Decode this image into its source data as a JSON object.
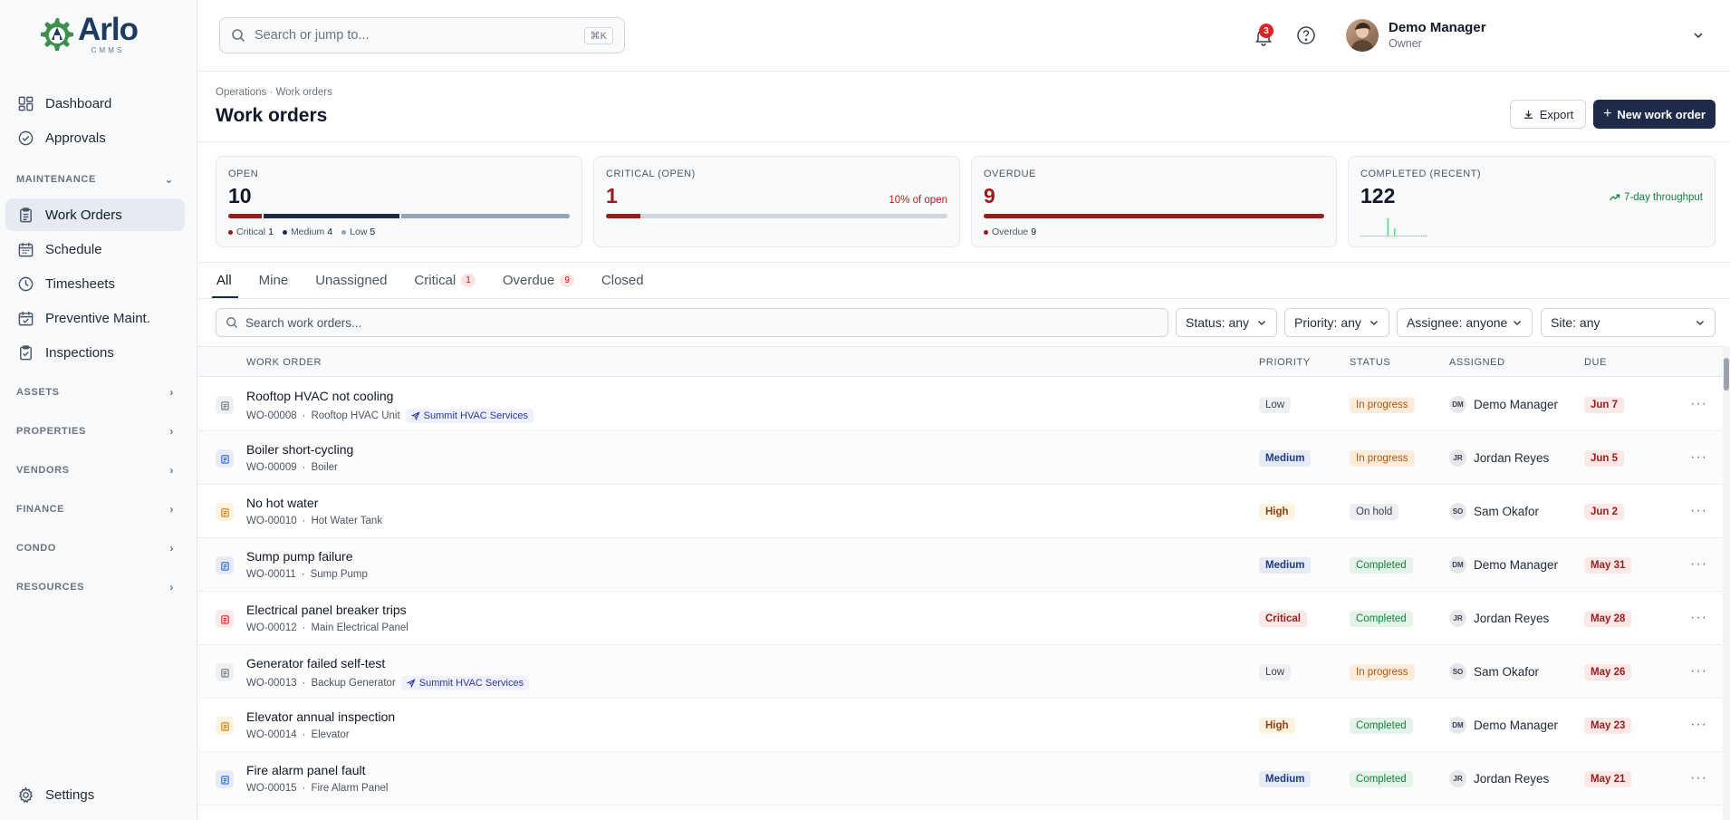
{
  "brand": {
    "name": "Arlo",
    "sub": "CMMS",
    "primary": "#1e3a5f",
    "accent": "#3d8f4e"
  },
  "sidebar": {
    "top_items": [
      {
        "label": "Dashboard",
        "icon": "dashboard-icon"
      },
      {
        "label": "Approvals",
        "icon": "check-circle-icon"
      }
    ],
    "maintenance": {
      "label": "MAINTENANCE",
      "items": [
        {
          "label": "Work Orders",
          "icon": "clipboard-icon",
          "active": true
        },
        {
          "label": "Schedule",
          "icon": "calendar-icon"
        },
        {
          "label": "Timesheets",
          "icon": "clock-icon"
        },
        {
          "label": "Preventive Maint.",
          "icon": "calendar-check-icon"
        },
        {
          "label": "Inspections",
          "icon": "clipboard-check-icon"
        }
      ]
    },
    "sections": [
      "ASSETS",
      "PROPERTIES",
      "VENDORS",
      "FINANCE",
      "CONDO",
      "RESOURCES"
    ],
    "settings_label": "Settings"
  },
  "topbar": {
    "search_placeholder": "Search or jump to...",
    "shortcut": "⌘K",
    "notification_count": "3",
    "user_name": "Demo Manager",
    "user_role": "Owner"
  },
  "header": {
    "breadcrumb": "Operations · Work orders",
    "title": "Work orders",
    "export_label": "Export",
    "new_label": "New work order"
  },
  "stats": {
    "open": {
      "label": "OPEN",
      "value": "10",
      "breakdown": [
        {
          "name": "Critical",
          "count": "1",
          "fraction": 0.1,
          "color": "#991b1b"
        },
        {
          "name": "Medium",
          "count": "4",
          "fraction": 0.4,
          "color": "#1e2a4a"
        },
        {
          "name": "Low",
          "count": "5",
          "fraction": 0.5,
          "color": "#94a3b8"
        }
      ]
    },
    "critical": {
      "label": "CRITICAL (OPEN)",
      "value": "1",
      "note": "10% of open",
      "fraction": 0.1
    },
    "overdue": {
      "label": "OVERDUE",
      "value": "9",
      "legend_name": "Overdue",
      "legend_count": "9",
      "fraction": 1.0
    },
    "completed": {
      "label": "COMPLETED (RECENT)",
      "value": "122",
      "note": "7-day throughput",
      "spark": [
        0,
        0,
        1,
        0,
        0,
        0,
        0,
        0,
        0,
        0,
        0,
        0,
        18,
        0,
        0,
        8,
        0,
        0,
        0,
        0,
        0,
        0,
        0,
        0,
        0,
        0,
        0,
        0,
        0,
        0
      ]
    }
  },
  "tabs": [
    {
      "label": "All",
      "active": true
    },
    {
      "label": "Mine"
    },
    {
      "label": "Unassigned"
    },
    {
      "label": "Critical",
      "badge": "1"
    },
    {
      "label": "Overdue",
      "badge": "9"
    },
    {
      "label": "Closed"
    }
  ],
  "filters": {
    "search_placeholder": "Search work orders...",
    "status": "Status: any",
    "priority": "Priority: any",
    "assignee": "Assignee: anyone",
    "site": "Site: any"
  },
  "table": {
    "headers": {
      "work_order": "WORK ORDER",
      "priority": "PRIORITY",
      "status": "STATUS",
      "assigned": "ASSIGNED",
      "due": "DUE"
    },
    "rows": [
      {
        "title": "Rooftop HVAC not cooling",
        "id": "WO-00008",
        "asset": "Rooftop HVAC Unit",
        "vendor": "Summit HVAC Services",
        "priority": "Low",
        "status": "In progress",
        "initials": "DM",
        "assignee": "Demo Manager",
        "due": "Jun 7"
      },
      {
        "title": "Boiler short-cycling",
        "id": "WO-00009",
        "asset": "Boiler",
        "vendor": "",
        "priority": "Medium",
        "status": "In progress",
        "initials": "JR",
        "assignee": "Jordan Reyes",
        "due": "Jun 5"
      },
      {
        "title": "No hot water",
        "id": "WO-00010",
        "asset": "Hot Water Tank",
        "vendor": "",
        "priority": "High",
        "status": "On hold",
        "initials": "SO",
        "assignee": "Sam Okafor",
        "due": "Jun 2"
      },
      {
        "title": "Sump pump failure",
        "id": "WO-00011",
        "asset": "Sump Pump",
        "vendor": "",
        "priority": "Medium",
        "status": "Completed",
        "initials": "DM",
        "assignee": "Demo Manager",
        "due": "May 31"
      },
      {
        "title": "Electrical panel breaker trips",
        "id": "WO-00012",
        "asset": "Main Electrical Panel",
        "vendor": "",
        "priority": "Critical",
        "status": "Completed",
        "initials": "JR",
        "assignee": "Jordan Reyes",
        "due": "May 28"
      },
      {
        "title": "Generator failed self-test",
        "id": "WO-00013",
        "asset": "Backup Generator",
        "vendor": "Summit HVAC Services",
        "priority": "Low",
        "status": "In progress",
        "initials": "SO",
        "assignee": "Sam Okafor",
        "due": "May 26"
      },
      {
        "title": "Elevator annual inspection",
        "id": "WO-00014",
        "asset": "Elevator",
        "vendor": "",
        "priority": "High",
        "status": "Completed",
        "initials": "DM",
        "assignee": "Demo Manager",
        "due": "May 23"
      },
      {
        "title": "Fire alarm panel fault",
        "id": "WO-00015",
        "asset": "Fire Alarm Panel",
        "vendor": "",
        "priority": "Medium",
        "status": "Completed",
        "initials": "JR",
        "assignee": "Jordan Reyes",
        "due": "May 21"
      }
    ]
  }
}
